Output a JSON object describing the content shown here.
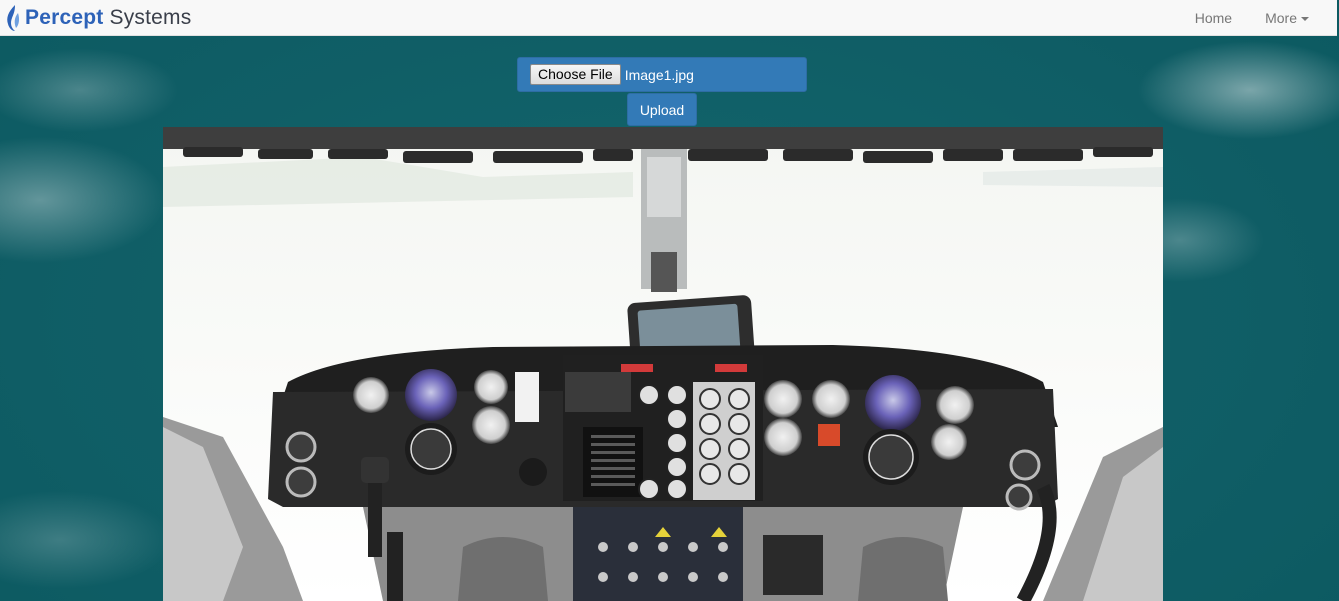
{
  "navbar": {
    "brand": {
      "part1": "Percept",
      "part2": "Systems",
      "icon": "flame-logo-icon"
    },
    "links": [
      {
        "label": "Home"
      },
      {
        "label": "More",
        "icon": "caret-down-icon"
      }
    ]
  },
  "upload": {
    "choose_label": "Choose File",
    "file_name": "Image1.jpg",
    "upload_label": "Upload"
  },
  "photo": {
    "subject": "helicopter-cockpit-image"
  },
  "colors": {
    "primary": "#337ab7",
    "navbar_bg": "#f8f8f8",
    "page_bg": "#12646b",
    "brand": "#2d62b8"
  }
}
